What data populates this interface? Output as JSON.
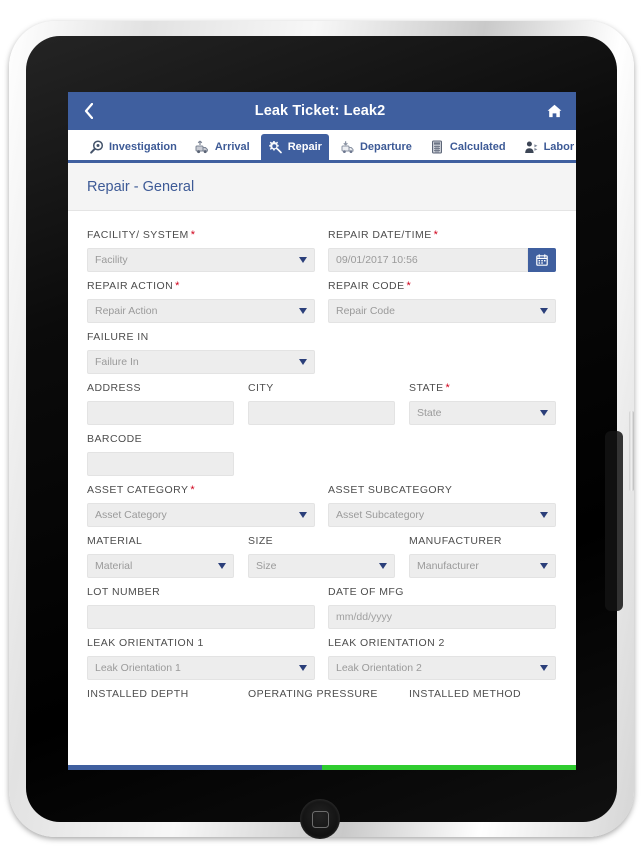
{
  "app": {
    "header": {
      "back_icon": "chevron-left-icon",
      "title": "Leak Ticket: Leak2",
      "home_icon": "home-icon",
      "bg_color": "#3f5f9f"
    },
    "tabs": [
      {
        "label": "Investigation",
        "icon": "magnifier-eye-icon",
        "active": false
      },
      {
        "label": "Arrival",
        "icon": "truck-arrival-icon",
        "active": false
      },
      {
        "label": "Repair",
        "icon": "gear-wrench-icon",
        "active": true
      },
      {
        "label": "Departure",
        "icon": "truck-departure-icon",
        "active": false
      },
      {
        "label": "Calculated",
        "icon": "calculator-icon",
        "active": false
      },
      {
        "label": "Labor",
        "icon": "worker-person-icon",
        "active": false
      }
    ]
  },
  "section": {
    "title": "Repair - General"
  },
  "form": {
    "rows": [
      {
        "fields": [
          {
            "label": "FACILITY/ SYSTEM",
            "required": true,
            "type": "select",
            "placeholder": "Facility",
            "value": "",
            "width": "half"
          },
          {
            "label": "REPAIR DATE/TIME",
            "required": true,
            "type": "datetime",
            "placeholder": "",
            "value": "09/01/2017 10:56",
            "width": "half",
            "button_icon": "calendar-icon"
          }
        ]
      },
      {
        "fields": [
          {
            "label": "REPAIR ACTION",
            "required": true,
            "type": "select",
            "placeholder": "Repair Action",
            "value": "",
            "width": "half"
          },
          {
            "label": "REPAIR CODE",
            "required": true,
            "type": "select",
            "placeholder": "Repair Code",
            "value": "",
            "width": "half"
          }
        ]
      },
      {
        "fields": [
          {
            "label": "FAILURE IN",
            "required": false,
            "type": "select",
            "placeholder": "Failure In",
            "value": "",
            "width": "half"
          }
        ]
      },
      {
        "fields": [
          {
            "label": "ADDRESS",
            "required": false,
            "type": "text",
            "placeholder": "",
            "value": "",
            "width": "third"
          },
          {
            "label": "CITY",
            "required": false,
            "type": "text",
            "placeholder": "",
            "value": "",
            "width": "third"
          },
          {
            "label": "STATE",
            "required": true,
            "type": "select",
            "placeholder": "State",
            "value": "",
            "width": "third"
          }
        ]
      },
      {
        "fields": [
          {
            "label": "BARCODE",
            "required": false,
            "type": "text",
            "placeholder": "",
            "value": "",
            "width": "barcode"
          }
        ]
      },
      {
        "fields": [
          {
            "label": "ASSET CATEGORY",
            "required": true,
            "type": "select",
            "placeholder": "Asset Category",
            "value": "",
            "width": "half"
          },
          {
            "label": "ASSET SUBCATEGORY",
            "required": false,
            "type": "select",
            "placeholder": "Asset Subcategory",
            "value": "",
            "width": "half"
          }
        ]
      },
      {
        "fields": [
          {
            "label": "MATERIAL",
            "required": false,
            "type": "select",
            "placeholder": "Material",
            "value": "",
            "width": "third"
          },
          {
            "label": "SIZE",
            "required": false,
            "type": "select",
            "placeholder": "Size",
            "value": "",
            "width": "third"
          },
          {
            "label": "MANUFACTURER",
            "required": false,
            "type": "select",
            "placeholder": "Manufacturer",
            "value": "",
            "width": "third"
          }
        ]
      },
      {
        "fields": [
          {
            "label": "LOT NUMBER",
            "required": false,
            "type": "text",
            "placeholder": "",
            "value": "",
            "width": "half"
          },
          {
            "label": "DATE OF MFG",
            "required": false,
            "type": "text",
            "placeholder": "mm/dd/yyyy",
            "value": "",
            "width": "half"
          }
        ]
      },
      {
        "fields": [
          {
            "label": "LEAK ORIENTATION 1",
            "required": false,
            "type": "select",
            "placeholder": "Leak Orientation 1",
            "value": "",
            "width": "half"
          },
          {
            "label": "LEAK ORIENTATION 2",
            "required": false,
            "type": "select",
            "placeholder": "Leak Orientation 2",
            "value": "",
            "width": "half"
          }
        ]
      },
      {
        "fields": [
          {
            "label": "INSTALLED DEPTH",
            "required": false,
            "type": "none",
            "placeholder": "",
            "value": "",
            "width": "third"
          },
          {
            "label": "OPERATING PRESSURE",
            "required": false,
            "type": "none",
            "placeholder": "",
            "value": "",
            "width": "third"
          },
          {
            "label": "INSTALLED METHOD",
            "required": false,
            "type": "none",
            "placeholder": "",
            "value": "",
            "width": "third"
          }
        ]
      }
    ]
  },
  "progress": {
    "completed_color": "#3f5f9f",
    "remaining_color": "#2fcc2f",
    "completed_percent": 50
  },
  "device": {
    "home_button": "home-button"
  }
}
